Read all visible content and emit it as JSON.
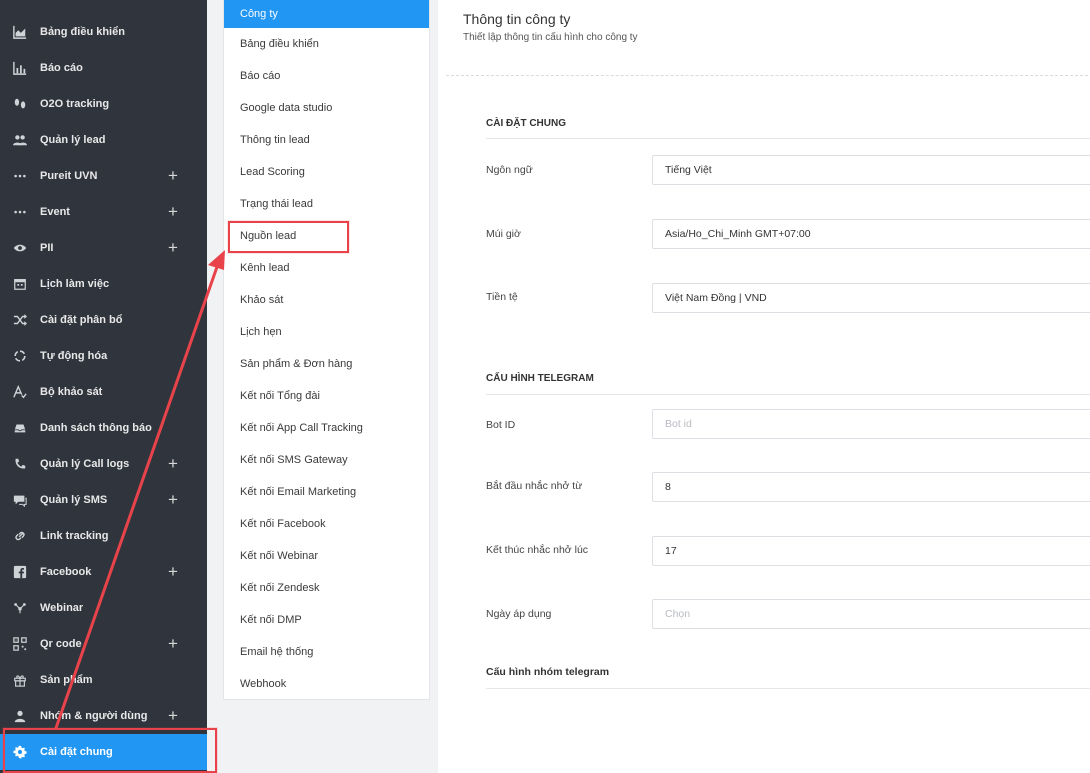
{
  "sidebar": {
    "items": [
      {
        "label": "Bảng điều khiển",
        "icon": "area-chart-icon",
        "plus": false
      },
      {
        "label": "Báo cáo",
        "icon": "bar-chart-icon",
        "plus": false
      },
      {
        "label": "O2O tracking",
        "icon": "footsteps-icon",
        "plus": false
      },
      {
        "label": "Quản lý lead",
        "icon": "users-icon",
        "plus": false
      },
      {
        "label": "Pureit UVN",
        "icon": "more-dots-icon",
        "plus": true
      },
      {
        "label": "Event",
        "icon": "more-dots-icon",
        "plus": true
      },
      {
        "label": "PII",
        "icon": "eye-icon",
        "plus": true
      },
      {
        "label": "Lịch làm việc",
        "icon": "calendar-icon",
        "plus": false
      },
      {
        "label": "Cài đặt phân bổ",
        "icon": "shuffle-icon",
        "plus": false
      },
      {
        "label": "Tự động hóa",
        "icon": "cycle-icon",
        "plus": false
      },
      {
        "label": "Bộ khảo sát",
        "icon": "survey-icon",
        "plus": false
      },
      {
        "label": "Danh sách thông báo",
        "icon": "notification-tray-icon",
        "plus": false
      },
      {
        "label": "Quản lý Call logs",
        "icon": "phone-icon",
        "plus": true
      },
      {
        "label": "Quản lý SMS",
        "icon": "chat-icon",
        "plus": true
      },
      {
        "label": "Link tracking",
        "icon": "link-icon",
        "plus": false
      },
      {
        "label": "Facebook",
        "icon": "facebook-icon",
        "plus": true
      },
      {
        "label": "Webinar",
        "icon": "webinar-icon",
        "plus": false
      },
      {
        "label": "Qr code",
        "icon": "qr-code-icon",
        "plus": true
      },
      {
        "label": "Sản phẩm",
        "icon": "gift-icon",
        "plus": false
      },
      {
        "label": "Nhóm & người dùng",
        "icon": "user-group-icon",
        "plus": true
      },
      {
        "label": "Cài đặt chung",
        "icon": "gear-icon",
        "plus": false,
        "active": true
      }
    ],
    "plus_glyph": "+"
  },
  "submenu": {
    "items": [
      {
        "label": "Công ty",
        "active": true
      },
      {
        "label": "Bảng điều khiển"
      },
      {
        "label": "Báo cáo"
      },
      {
        "label": "Google data studio"
      },
      {
        "label": "Thông tin lead"
      },
      {
        "label": "Lead Scoring"
      },
      {
        "label": "Trạng thái lead"
      },
      {
        "label": "Nguồn lead",
        "highlighted": true
      },
      {
        "label": "Kênh lead"
      },
      {
        "label": "Khảo sát"
      },
      {
        "label": "Lịch hẹn"
      },
      {
        "label": "Sản phẩm & Đơn hàng"
      },
      {
        "label": "Kết nối Tổng đài"
      },
      {
        "label": "Kết nối App Call Tracking"
      },
      {
        "label": "Kết nối SMS Gateway"
      },
      {
        "label": "Kết nối Email Marketing"
      },
      {
        "label": "Kết nối Facebook"
      },
      {
        "label": "Kết nối Webinar"
      },
      {
        "label": "Kết nối Zendesk"
      },
      {
        "label": "Kết nối DMP"
      },
      {
        "label": "Email hệ thống"
      },
      {
        "label": "Webhook"
      }
    ]
  },
  "content": {
    "title": "Thông tin công ty",
    "subtitle": "Thiết lập thông tin cấu hình cho công ty",
    "general": {
      "section_title": "CÀI ĐẶT CHUNG",
      "language_label": "Ngôn ngữ",
      "language_value": "Tiếng Việt",
      "timezone_label": "Múi giờ",
      "timezone_value": "Asia/Ho_Chi_Minh GMT+07:00",
      "currency_label": "Tiền tệ",
      "currency_value": "Việt Nam Đồng | VND"
    },
    "telegram": {
      "section_title": "CẤU HÌNH TELEGRAM",
      "bot_id_label": "Bot ID",
      "bot_id_value": "",
      "bot_id_placeholder": "Bot id",
      "remind_start_label": "Bắt đầu nhắc nhở từ",
      "remind_start_value": "8",
      "remind_end_label": "Kết thúc nhắc nhở lúc",
      "remind_end_value": "17",
      "apply_date_label": "Ngày áp dụng",
      "apply_date_value": "",
      "apply_date_placeholder": "Chọn",
      "group_section_title": "Cấu hình nhóm telegram"
    }
  },
  "colors": {
    "sidebar_bg": "#30353d",
    "accent": "#2196f3",
    "highlight_red": "#e8434a"
  }
}
